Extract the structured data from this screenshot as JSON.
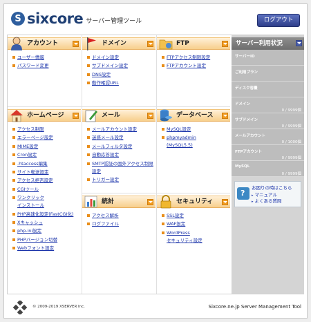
{
  "header": {
    "logo_text": "sixcore",
    "logo_sub": "サーバー管理ツール",
    "logout_label": "ログアウト"
  },
  "sections": {
    "account": {
      "title": "アカウント",
      "links": [
        "ユーザー情報",
        "パスワード変更"
      ]
    },
    "domain": {
      "title": "ドメイン",
      "links": [
        "ドメイン設定",
        "サブドメイン設定",
        "DNS設定",
        "動作確認URL"
      ]
    },
    "ftp": {
      "title": "FTP",
      "links": [
        "FTPアクセス制限設定",
        "FTPアカウント設定"
      ]
    },
    "homepage": {
      "title": "ホームページ",
      "links": [
        "アクセス制限",
        "エラーページ設定",
        "MIME設定",
        "Cron設定",
        ".htaccess編集",
        "サイト転送設定",
        "アクセス拒否設定",
        "CGIツール"
      ],
      "multi": [
        "ワンクリック",
        "インストール"
      ],
      "links2": [
        "PHP高速化設定(FastCGI化)",
        "Xキャッシュ",
        "php.ini設定",
        "PHPバージョン切替",
        "Webフォント設定"
      ]
    },
    "mail": {
      "title": "メール",
      "links": [
        "メールアカウント設定",
        "迷惑メール設定",
        "メールフィルタ設定",
        "自動応答設定"
      ],
      "multi": [
        "SMTP認証の国外アクセス制限",
        "設定"
      ],
      "links2": [
        "トリガー設定"
      ]
    },
    "database": {
      "title": "データベース",
      "links": [
        "MySQL設定"
      ],
      "multi": [
        "phpmyadmin",
        "(MySQL5.5)"
      ]
    },
    "stats": {
      "title": "統計",
      "links": [
        "アクセス解析",
        "ログファイル"
      ]
    },
    "security": {
      "title": "セキュリティ",
      "links": [
        "SSL設定",
        "WAF設定"
      ],
      "multi": [
        "WordPress",
        "セキュリティ設定"
      ]
    }
  },
  "side": {
    "title": "サーバー利用状況",
    "stats": [
      {
        "label": "サーバーID",
        "value": ""
      },
      {
        "label": "ご利用プラン",
        "value": ""
      },
      {
        "label": "ディスク容量",
        "value": ""
      },
      {
        "label": "ドメイン",
        "value": "0 / 9999個"
      },
      {
        "label": "サブドメイン",
        "value": "0 / 9999個"
      },
      {
        "label": "メールアカウント",
        "value": "0 / 1000個"
      },
      {
        "label": "FTPアカウント",
        "value": "0 / 9999個"
      },
      {
        "label": "MySQL",
        "value": "0 / 9999個"
      }
    ],
    "help": {
      "title": "お困りの時はこちら",
      "items": [
        "マニュアル",
        "よくある質問"
      ]
    }
  },
  "footer": {
    "copyright": "© 2009-2019 XSERVER Inc.",
    "tool_name": "Sixcore.ne.jp Server Management Tool"
  },
  "colors": {
    "brand": "#1f3f74",
    "section_header": "#f7cf8c",
    "link": "#1a33aa",
    "bullet": "#e98e1b",
    "side_bg": "#d4d4d4"
  }
}
